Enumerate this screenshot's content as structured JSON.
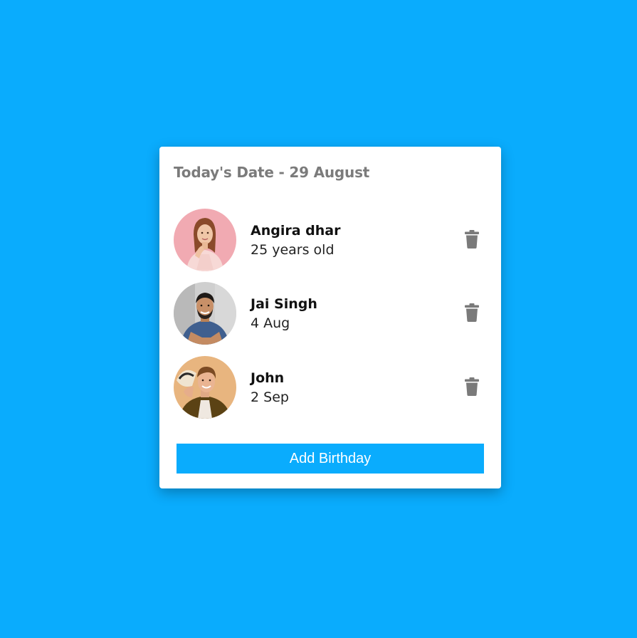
{
  "page": {
    "background_color": "#0aacfd",
    "accent_color": "#0aacfd"
  },
  "card": {
    "title": "Today's Date - 29 August"
  },
  "people": [
    {
      "name": "Angira dhar",
      "detail": "25 years old",
      "avatar": "woman-portrait-avatar",
      "delete_icon": "trash-icon"
    },
    {
      "name": "Jai Singh",
      "detail": "4 Aug",
      "avatar": "man-portrait-avatar",
      "delete_icon": "trash-icon"
    },
    {
      "name": "John",
      "detail": "2 Sep",
      "avatar": "man-with-hat-portrait-avatar",
      "delete_icon": "trash-icon"
    }
  ],
  "actions": {
    "add_label": "Add Birthday"
  }
}
